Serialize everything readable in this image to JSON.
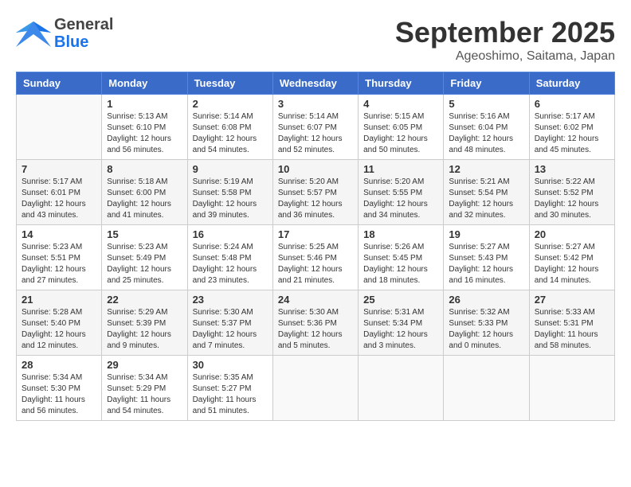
{
  "header": {
    "logo_general": "General",
    "logo_blue": "Blue",
    "month": "September 2025",
    "location": "Ageoshimo, Saitama, Japan"
  },
  "days_of_week": [
    "Sunday",
    "Monday",
    "Tuesday",
    "Wednesday",
    "Thursday",
    "Friday",
    "Saturday"
  ],
  "weeks": [
    [
      {
        "num": "",
        "info": ""
      },
      {
        "num": "1",
        "info": "Sunrise: 5:13 AM\nSunset: 6:10 PM\nDaylight: 12 hours\nand 56 minutes."
      },
      {
        "num": "2",
        "info": "Sunrise: 5:14 AM\nSunset: 6:08 PM\nDaylight: 12 hours\nand 54 minutes."
      },
      {
        "num": "3",
        "info": "Sunrise: 5:14 AM\nSunset: 6:07 PM\nDaylight: 12 hours\nand 52 minutes."
      },
      {
        "num": "4",
        "info": "Sunrise: 5:15 AM\nSunset: 6:05 PM\nDaylight: 12 hours\nand 50 minutes."
      },
      {
        "num": "5",
        "info": "Sunrise: 5:16 AM\nSunset: 6:04 PM\nDaylight: 12 hours\nand 48 minutes."
      },
      {
        "num": "6",
        "info": "Sunrise: 5:17 AM\nSunset: 6:02 PM\nDaylight: 12 hours\nand 45 minutes."
      }
    ],
    [
      {
        "num": "7",
        "info": "Sunrise: 5:17 AM\nSunset: 6:01 PM\nDaylight: 12 hours\nand 43 minutes."
      },
      {
        "num": "8",
        "info": "Sunrise: 5:18 AM\nSunset: 6:00 PM\nDaylight: 12 hours\nand 41 minutes."
      },
      {
        "num": "9",
        "info": "Sunrise: 5:19 AM\nSunset: 5:58 PM\nDaylight: 12 hours\nand 39 minutes."
      },
      {
        "num": "10",
        "info": "Sunrise: 5:20 AM\nSunset: 5:57 PM\nDaylight: 12 hours\nand 36 minutes."
      },
      {
        "num": "11",
        "info": "Sunrise: 5:20 AM\nSunset: 5:55 PM\nDaylight: 12 hours\nand 34 minutes."
      },
      {
        "num": "12",
        "info": "Sunrise: 5:21 AM\nSunset: 5:54 PM\nDaylight: 12 hours\nand 32 minutes."
      },
      {
        "num": "13",
        "info": "Sunrise: 5:22 AM\nSunset: 5:52 PM\nDaylight: 12 hours\nand 30 minutes."
      }
    ],
    [
      {
        "num": "14",
        "info": "Sunrise: 5:23 AM\nSunset: 5:51 PM\nDaylight: 12 hours\nand 27 minutes."
      },
      {
        "num": "15",
        "info": "Sunrise: 5:23 AM\nSunset: 5:49 PM\nDaylight: 12 hours\nand 25 minutes."
      },
      {
        "num": "16",
        "info": "Sunrise: 5:24 AM\nSunset: 5:48 PM\nDaylight: 12 hours\nand 23 minutes."
      },
      {
        "num": "17",
        "info": "Sunrise: 5:25 AM\nSunset: 5:46 PM\nDaylight: 12 hours\nand 21 minutes."
      },
      {
        "num": "18",
        "info": "Sunrise: 5:26 AM\nSunset: 5:45 PM\nDaylight: 12 hours\nand 18 minutes."
      },
      {
        "num": "19",
        "info": "Sunrise: 5:27 AM\nSunset: 5:43 PM\nDaylight: 12 hours\nand 16 minutes."
      },
      {
        "num": "20",
        "info": "Sunrise: 5:27 AM\nSunset: 5:42 PM\nDaylight: 12 hours\nand 14 minutes."
      }
    ],
    [
      {
        "num": "21",
        "info": "Sunrise: 5:28 AM\nSunset: 5:40 PM\nDaylight: 12 hours\nand 12 minutes."
      },
      {
        "num": "22",
        "info": "Sunrise: 5:29 AM\nSunset: 5:39 PM\nDaylight: 12 hours\nand 9 minutes."
      },
      {
        "num": "23",
        "info": "Sunrise: 5:30 AM\nSunset: 5:37 PM\nDaylight: 12 hours\nand 7 minutes."
      },
      {
        "num": "24",
        "info": "Sunrise: 5:30 AM\nSunset: 5:36 PM\nDaylight: 12 hours\nand 5 minutes."
      },
      {
        "num": "25",
        "info": "Sunrise: 5:31 AM\nSunset: 5:34 PM\nDaylight: 12 hours\nand 3 minutes."
      },
      {
        "num": "26",
        "info": "Sunrise: 5:32 AM\nSunset: 5:33 PM\nDaylight: 12 hours\nand 0 minutes."
      },
      {
        "num": "27",
        "info": "Sunrise: 5:33 AM\nSunset: 5:31 PM\nDaylight: 11 hours\nand 58 minutes."
      }
    ],
    [
      {
        "num": "28",
        "info": "Sunrise: 5:34 AM\nSunset: 5:30 PM\nDaylight: 11 hours\nand 56 minutes."
      },
      {
        "num": "29",
        "info": "Sunrise: 5:34 AM\nSunset: 5:29 PM\nDaylight: 11 hours\nand 54 minutes."
      },
      {
        "num": "30",
        "info": "Sunrise: 5:35 AM\nSunset: 5:27 PM\nDaylight: 11 hours\nand 51 minutes."
      },
      {
        "num": "",
        "info": ""
      },
      {
        "num": "",
        "info": ""
      },
      {
        "num": "",
        "info": ""
      },
      {
        "num": "",
        "info": ""
      }
    ]
  ]
}
